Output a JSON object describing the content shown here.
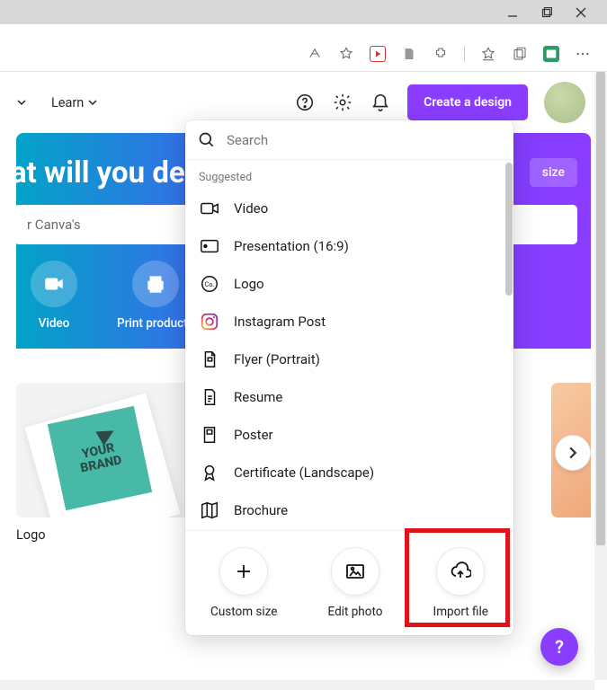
{
  "window_controls": {
    "minimize": "minimize",
    "maximize": "maximize",
    "close": "close"
  },
  "header": {
    "nav1": "",
    "nav2": "Learn",
    "create_label": "Create a design"
  },
  "hero": {
    "headline": "at will you des",
    "custom_size": "size",
    "search_placeholder": "r Canva's",
    "actions": [
      "Video",
      "Print products"
    ]
  },
  "try": {
    "brand_line1": "YOUR",
    "brand_line2": "BRAND",
    "card_label": "Logo"
  },
  "panel": {
    "search_placeholder": "Search",
    "section_label": "Suggested",
    "items": [
      "Video",
      "Presentation (16:9)",
      "Logo",
      "Instagram Post",
      "Flyer (Portrait)",
      "Resume",
      "Poster",
      "Certificate (Landscape)",
      "Brochure"
    ],
    "footer": [
      "Custom size",
      "Edit photo",
      "Import file"
    ]
  },
  "fab": "?"
}
